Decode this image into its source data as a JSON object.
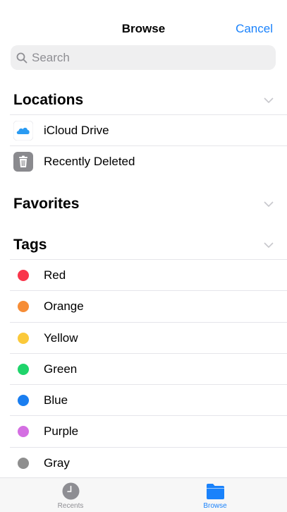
{
  "header": {
    "title": "Browse",
    "cancel_label": "Cancel"
  },
  "search": {
    "placeholder": "Search"
  },
  "locations": {
    "title": "Locations",
    "items": [
      {
        "label": "iCloud Drive",
        "icon": "icloud-icon"
      },
      {
        "label": "Recently Deleted",
        "icon": "trash-icon"
      }
    ]
  },
  "favorites": {
    "title": "Favorites"
  },
  "tags": {
    "title": "Tags",
    "items": [
      {
        "label": "Red",
        "color": "#f9364b"
      },
      {
        "label": "Orange",
        "color": "#f68d36"
      },
      {
        "label": "Yellow",
        "color": "#fbc93a"
      },
      {
        "label": "Green",
        "color": "#1fd46b"
      },
      {
        "label": "Blue",
        "color": "#1a7ef0"
      },
      {
        "label": "Purple",
        "color": "#d46fe2"
      },
      {
        "label": "Gray",
        "color": "#8e8e8e"
      }
    ]
  },
  "tabbar": {
    "tabs": [
      {
        "label": "Recents",
        "icon": "clock-icon",
        "color": "#8e8e93",
        "selected": false
      },
      {
        "label": "Browse",
        "icon": "folder-icon",
        "color": "#1a82fb",
        "selected": true
      }
    ]
  },
  "colors": {
    "accent": "#1a82fb",
    "separator": "#e5e5ea",
    "search_bg": "#efeff0"
  }
}
